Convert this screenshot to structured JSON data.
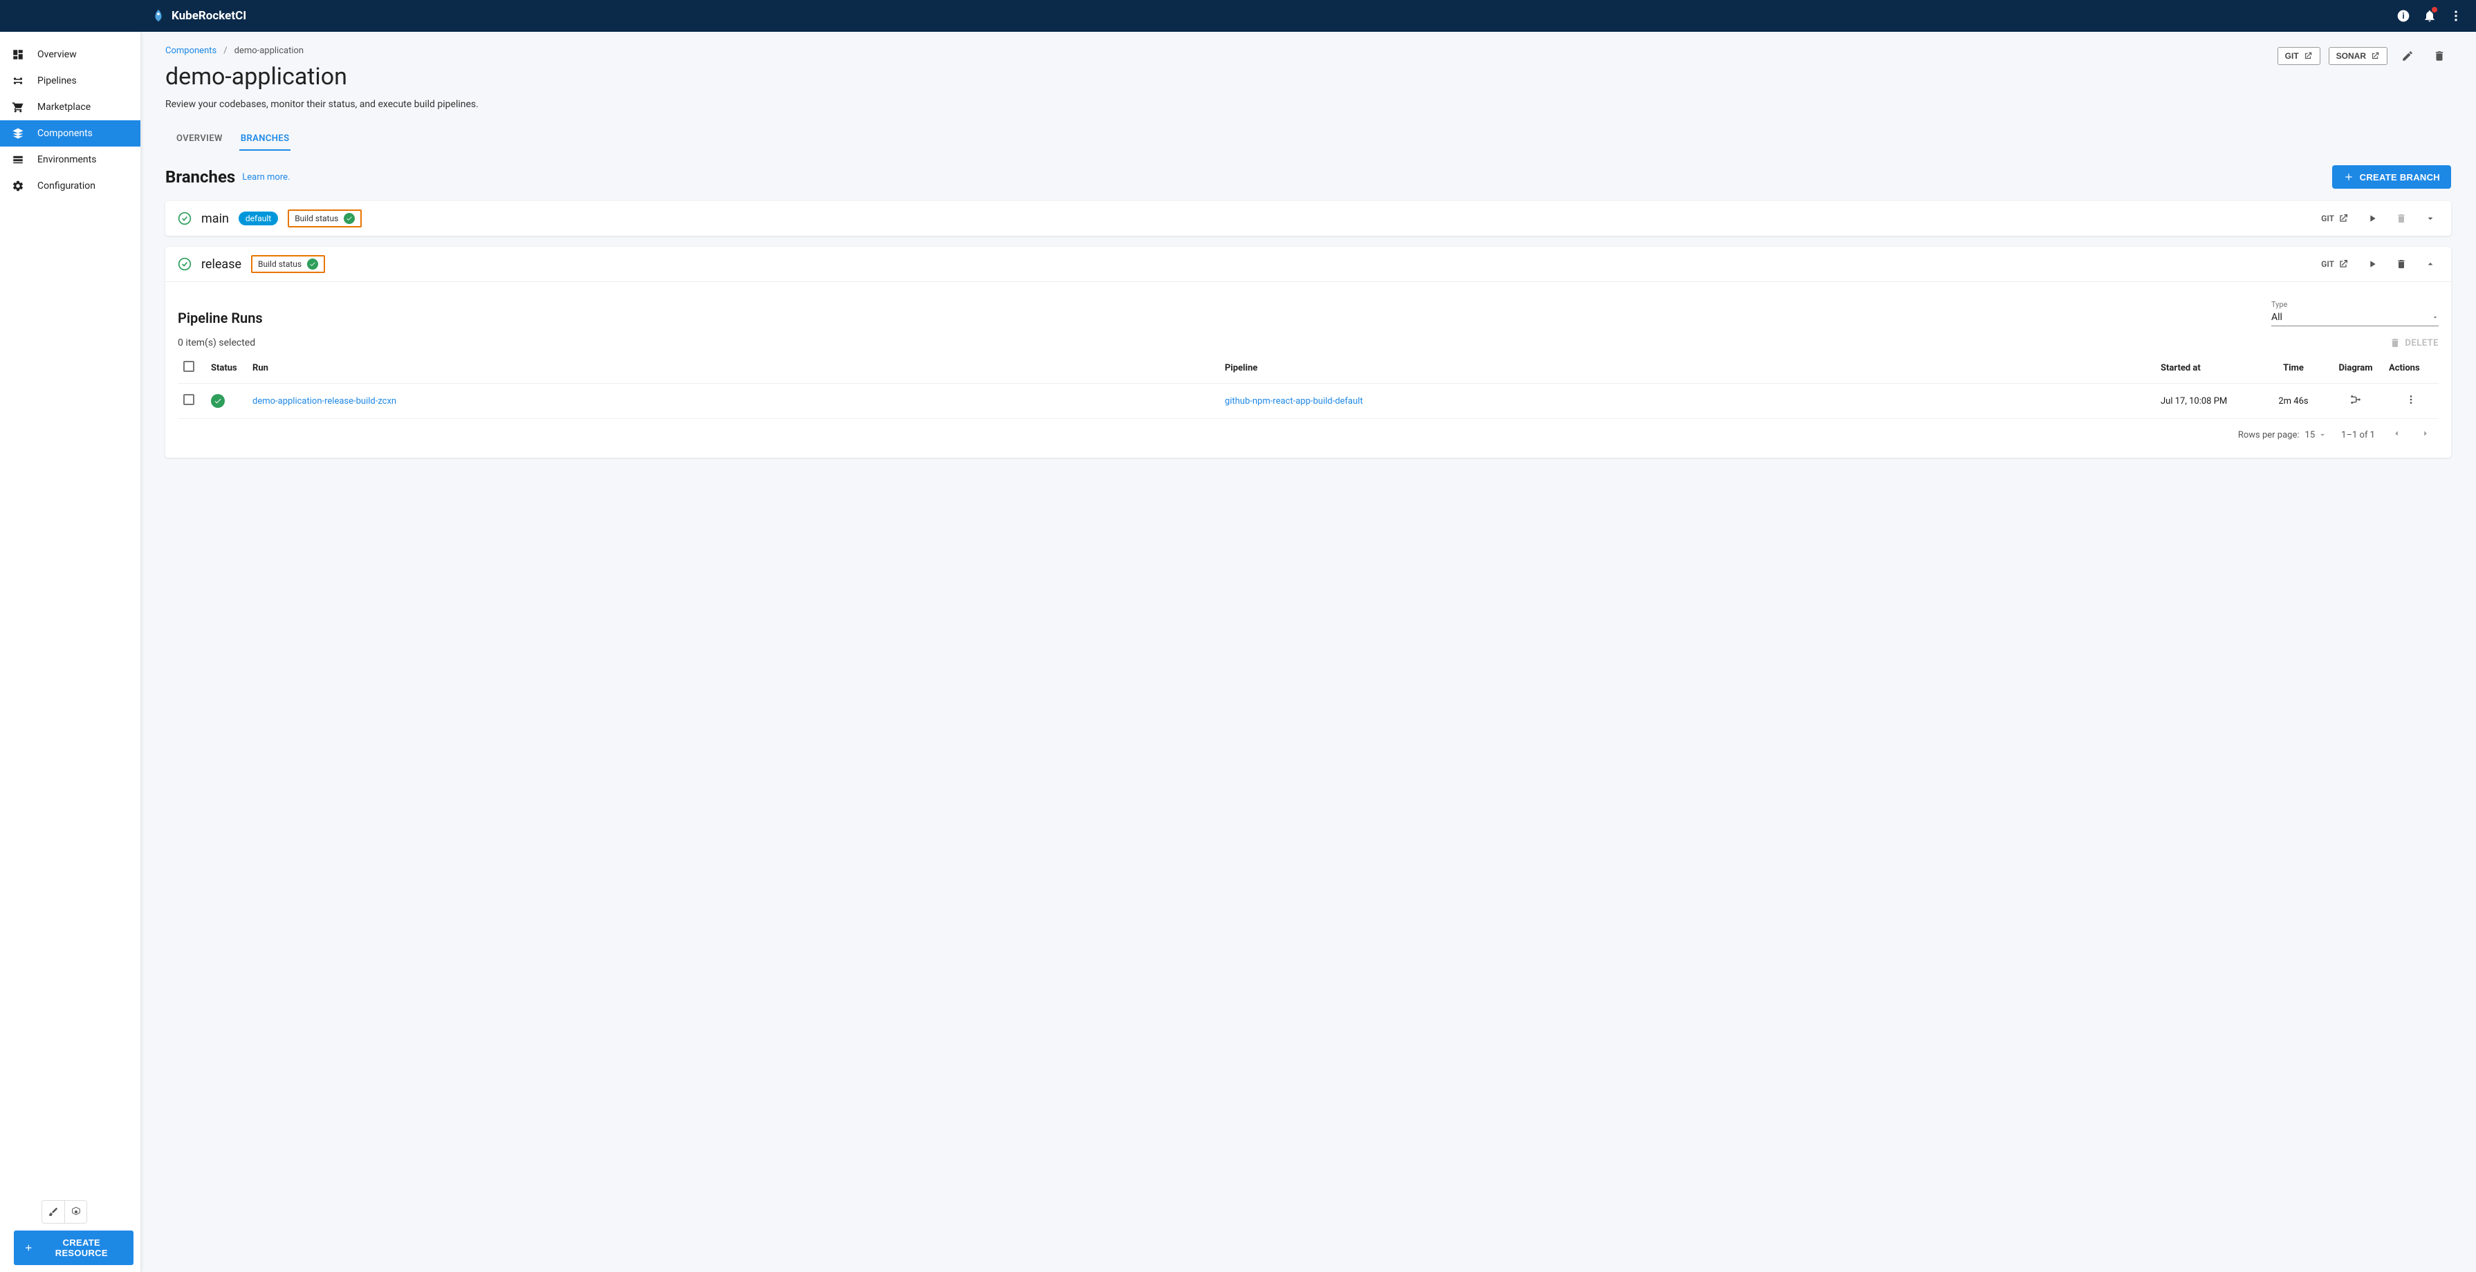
{
  "brand": "KubeRocketCI",
  "sidebar": {
    "items": [
      {
        "label": "Overview"
      },
      {
        "label": "Pipelines"
      },
      {
        "label": "Marketplace"
      },
      {
        "label": "Components"
      },
      {
        "label": "Environments"
      },
      {
        "label": "Configuration"
      }
    ],
    "create_resource": "CREATE RESOURCE"
  },
  "breadcrumb": {
    "root": "Components",
    "current": "demo-application"
  },
  "page": {
    "title": "demo-application",
    "desc": "Review your codebases, monitor their status, and execute build pipelines.",
    "git_btn": "GIT",
    "sonar_btn": "SONAR"
  },
  "tabs": {
    "overview": "OVERVIEW",
    "branches": "BRANCHES"
  },
  "branches": {
    "title": "Branches",
    "learn_more": "Learn more.",
    "create": "CREATE BRANCH",
    "git_label": "GIT",
    "items": [
      {
        "name": "main",
        "pill": "default",
        "build": "Build status"
      },
      {
        "name": "release",
        "build": "Build status"
      }
    ]
  },
  "pipeline_runs": {
    "title": "Pipeline Runs",
    "type_label": "Type",
    "type_value": "All",
    "selected": "0 item(s) selected",
    "delete": "DELETE",
    "cols": {
      "status": "Status",
      "run": "Run",
      "pipeline": "Pipeline",
      "started": "Started at",
      "time": "Time",
      "diagram": "Diagram",
      "actions": "Actions"
    },
    "rows": [
      {
        "run": "demo-application-release-build-zcxn",
        "pipeline": "github-npm-react-app-build-default",
        "started": "Jul 17, 10:08 PM",
        "time": "2m 46s"
      }
    ],
    "pagination": {
      "rows_per_page_label": "Rows per page:",
      "rows_per_page": "15",
      "range": "1–1 of 1"
    }
  }
}
